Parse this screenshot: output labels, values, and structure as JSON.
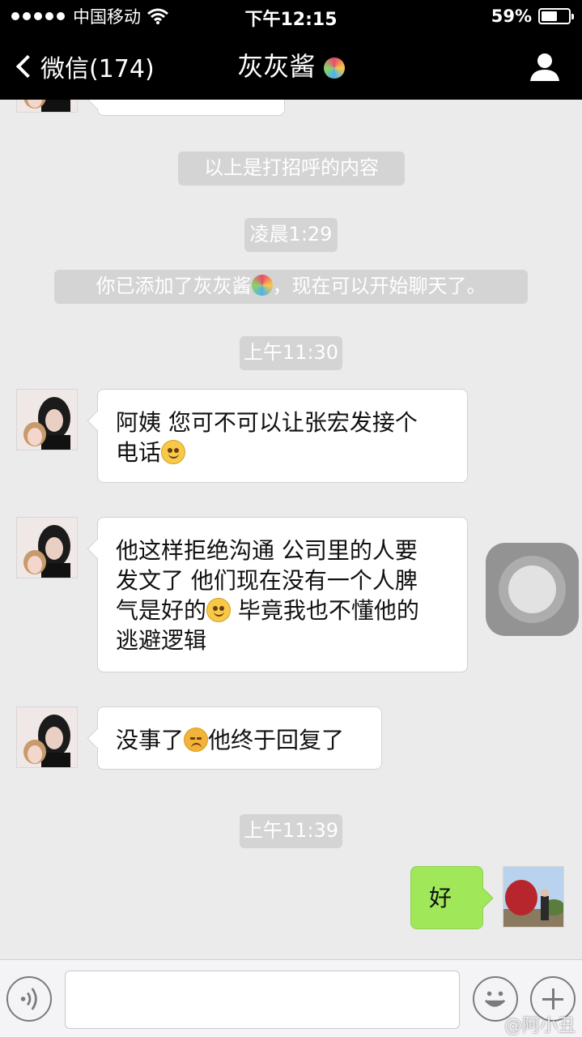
{
  "status_bar": {
    "carrier": "中国移动",
    "time": "下午12:15",
    "battery_percent": "59%",
    "battery_level": 0.59
  },
  "nav": {
    "back_label": "微信(174)",
    "title": "灰灰酱"
  },
  "messages": {
    "partial_bubble": "",
    "system_greeting": "以上是打招呼的内容",
    "time_1": "凌晨1:29",
    "system_added": "你已添加了灰灰酱",
    "system_added_suffix": "，现在可以开始聊天了。",
    "time_2": "上午11:30",
    "msg_1_line1": "阿姨 您可不可以让张宏发接个",
    "msg_1_line2": "电话",
    "msg_2_line1": "他这样拒绝沟通 公司里的人要",
    "msg_2_line2": "发文了 他们现在没有一个人脾",
    "msg_2_line3a": "气是好的",
    "msg_2_line3b": " 毕竟我也不懂他的",
    "msg_2_line4": "逃避逻辑",
    "msg_3a": "没事了",
    "msg_3b": "他终于回复了",
    "time_3": "上午11:39",
    "reply": "好"
  },
  "input": {
    "value": "",
    "placeholder": ""
  },
  "watermark": "@阿小丑",
  "colors": {
    "nav_bg": "#000000",
    "chat_bg": "#ebebeb",
    "own_bubble": "#a0e75a",
    "system_pill": "#d4d4d4"
  },
  "icons": [
    "signal-dots-icon",
    "wifi-icon",
    "battery-icon",
    "chevron-left-icon",
    "lollipop-icon",
    "person-icon",
    "smile-emoji-icon",
    "angry-emoji-icon",
    "voice-icon",
    "emoji-icon",
    "plus-icon",
    "assistive-touch-icon"
  ]
}
